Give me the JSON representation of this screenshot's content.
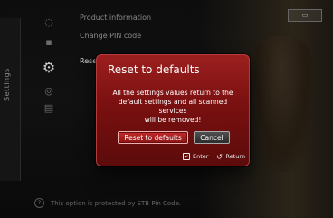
{
  "sidebar": {
    "label": "Settings"
  },
  "menu": {
    "items": [
      {
        "label": "Product information"
      },
      {
        "label": "Change PIN code"
      },
      {
        "label": "Reset"
      }
    ]
  },
  "dialog": {
    "title": "Reset to defaults",
    "message_lines": [
      "All the settings values return to the",
      "default settings and all scanned services",
      "will be removed!"
    ],
    "buttons": {
      "primary": "Reset to defaults",
      "secondary": "Cancel"
    },
    "hints": {
      "enter": "Enter",
      "return": "Return"
    }
  },
  "status": {
    "text": "This option is protected by STB Pin Code."
  },
  "icons": {
    "info": "info-icon",
    "pin": "lock-icon",
    "settings": "gear-icon",
    "reset": "reset-icon",
    "signal": "signal-icon",
    "help": "help-icon"
  },
  "colors": {
    "dialog_red": "#8d1515",
    "accent_border": "#f0b0b0"
  }
}
